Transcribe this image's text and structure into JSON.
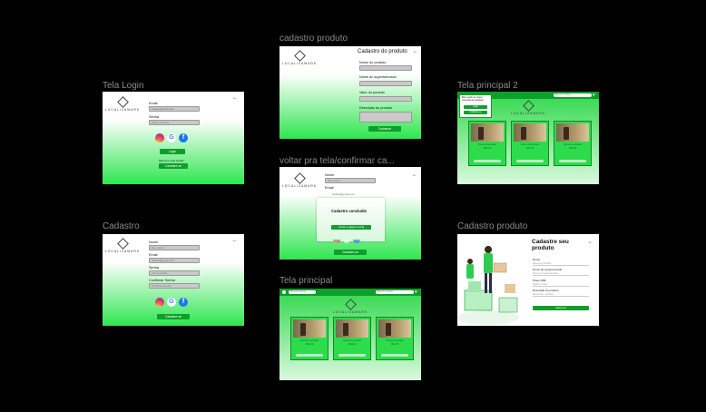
{
  "labels": {
    "login": "Tela Login",
    "cadastro": "Cadastro",
    "cadastro_produto": "cadastro produto",
    "voltar": "voltar pra tela/confirmar ca...",
    "principal": "Tela principal",
    "principal2": "Tela principal 2",
    "cadastro_produto2": "Cadastro produto"
  },
  "brand": "LOCALIZAMARK",
  "back_arrow": "←",
  "login": {
    "email_label": "Email",
    "email_value": "hadan@gmail.com",
    "senha_label": "Senha",
    "senha_value": "Digite a senha",
    "login_button": "Login",
    "no_account": "Não tem uma conta?",
    "signup_button": "Cadastre-se"
  },
  "cadastro": {
    "nome_label": "Nome",
    "nome_value": "Seu nome",
    "email_label": "Email",
    "email_value": "hadan@gmail.com",
    "senha_label": "Senha",
    "senha_value": "Crie a senha",
    "confirmar_label": "Confirmar Senha",
    "confirmar_value": "Confirme senha",
    "signup_button": "Cadastre-se"
  },
  "produto": {
    "title": "Cadastro do produto",
    "fields": [
      "Nome do produto",
      "Nome do supermercado",
      "Valor do produto",
      "Descrição do produto"
    ],
    "button": "Cadastrar"
  },
  "confirm": {
    "nome_label": "Nome",
    "nome_value": "Seu nome",
    "email_label": "Email",
    "email_value": "hadan@gmail.com",
    "dialog_title": "Cadastro concluído",
    "dialog_button": "Voltar à página inicial",
    "signup_button": "Cadastre-se"
  },
  "principal": {
    "search_placeholder": "Buscar produto",
    "cards": [
      {
        "title": "Nome do produto",
        "price": "R$ 0,00"
      },
      {
        "title": "Nome do produto",
        "price": "R$ 0,00"
      },
      {
        "title": "Nome do produto",
        "price": "R$ 0,00"
      }
    ]
  },
  "principal2": {
    "search_placeholder": "Buscar produto",
    "menu_title": "Bem-vindo ao nosso mercado de produtos",
    "menu_items": [
      "Login",
      "Cadastre-se"
    ]
  },
  "produto2": {
    "title": "Cadastre seu produto",
    "fields": [
      {
        "label": "Nome",
        "placeholder": "Nome do produto"
      },
      {
        "label": "Nome do supermercado",
        "placeholder": "Nome do supermercado"
      },
      {
        "label": "Preço (R$)",
        "placeholder": "Digite o preço"
      },
      {
        "label": "Descrição do produto",
        "placeholder": "Descreva o produto"
      }
    ],
    "button": "Adicionar"
  },
  "colors": {
    "accent": "#0e9f2a",
    "bright": "#2ee64f",
    "background": "#000000"
  }
}
